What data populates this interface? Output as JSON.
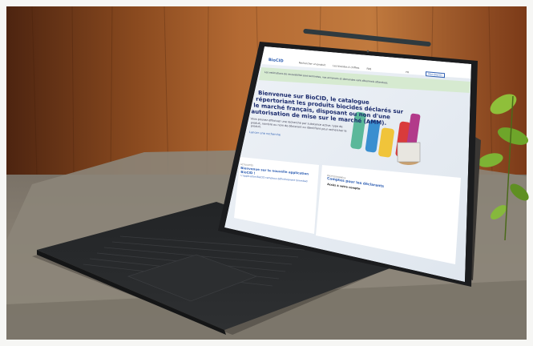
{
  "screen": {
    "brand": "BioCID",
    "nav": [
      "Rechercher un produit",
      "Les biocides à chiffres",
      "FAQ"
    ],
    "lang": "FR",
    "button": "Mon BioCID",
    "banner": "Les estimations de recevabilité sont terminées, vos annonces et demandes sont désormais attendues.",
    "hero_title_lines": [
      "Bienvenue sur BioCID, le catalogue",
      "répertoriant les produits biocides déclarés sur",
      "le marché français, disposant ou non d'une",
      "autorisation de mise sur le marché (AMM)."
    ],
    "hero_desc": "Vous pouvez effectuer une recherche par substance active, type de produit, nombre ou nom de déclarant ou identifiant pour rechercher le produit.",
    "hero_link": "Lancer une recherche",
    "card1_tag": "ACTUALITÉS",
    "card1_title": "Bienvenue sur la nouvelle application BioCID !",
    "card1_subtitle": "L'application BioCID remplace définitivement Simmbad",
    "card2_tag": "PROFESSIONNELS",
    "card2_title": "Comptes pour les déclarants",
    "card2_subtitle": "Accès à votre compte"
  },
  "colors": {
    "wood_dark": "#6a3416",
    "wood_light": "#b56a32",
    "table": "#8a8377",
    "keyboard": "#2a2b2c",
    "screen_bg": "#e9eef4",
    "banner": "#d9ecd2",
    "title": "#1a2a6c",
    "link": "#2f5fb3"
  }
}
